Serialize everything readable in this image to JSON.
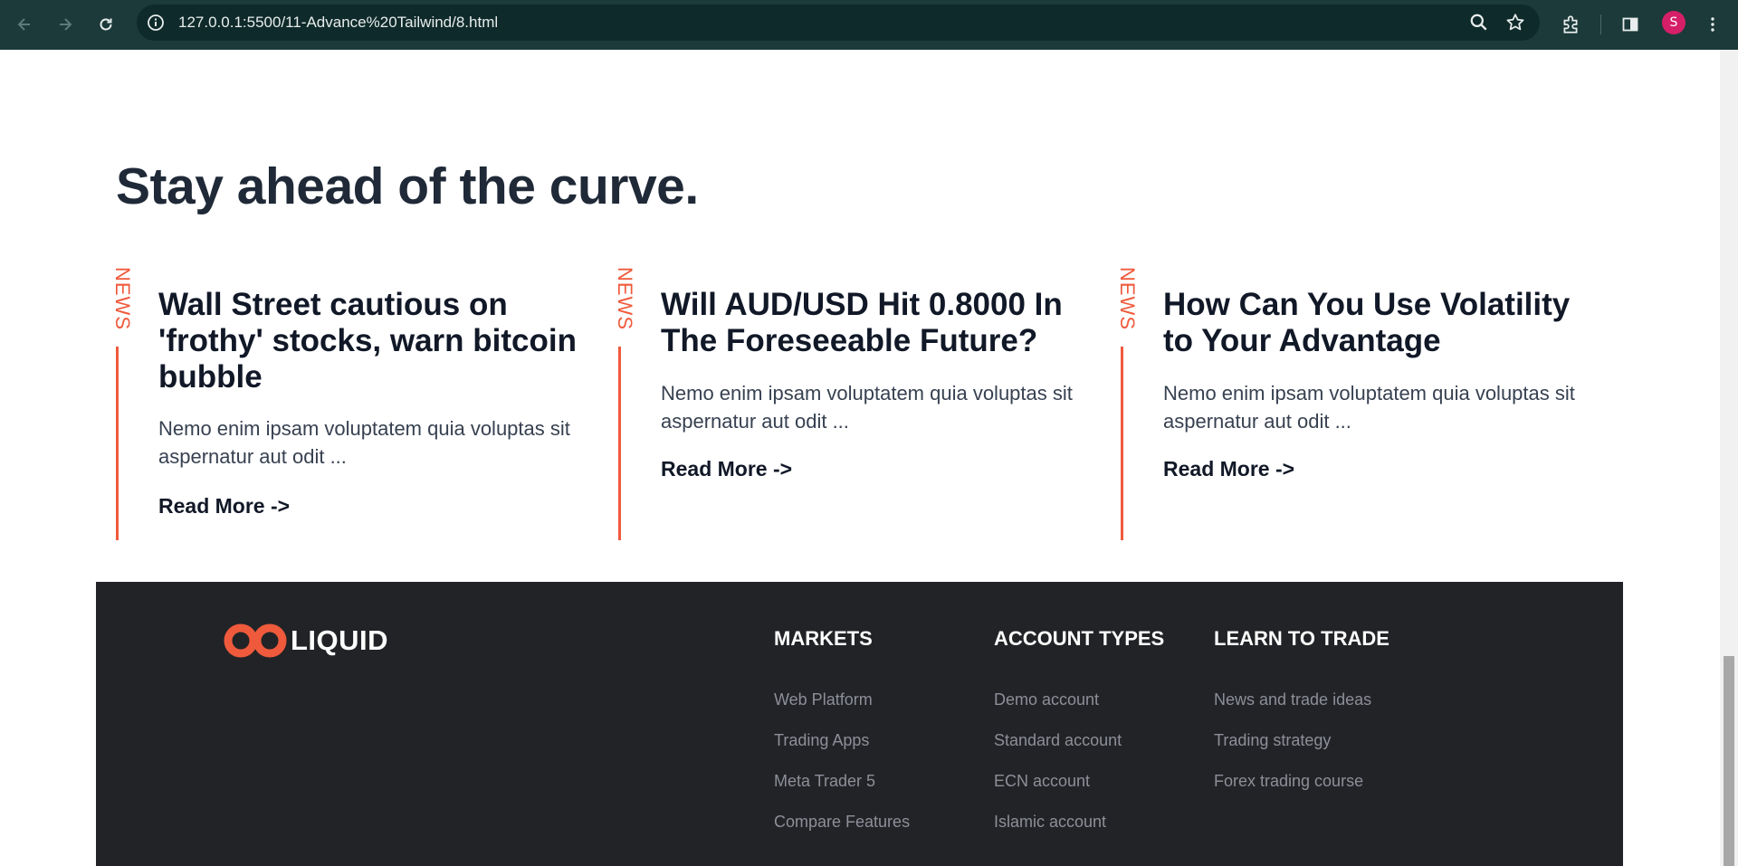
{
  "browser": {
    "url": "127.0.0.1:5500/11-Advance%20Tailwind/8.html",
    "profile_initial": "S",
    "icons": [
      "back-icon",
      "forward-icon",
      "reload-icon",
      "info-icon",
      "zoom-icon",
      "star-icon",
      "extensions-icon",
      "side-panel-icon",
      "menu-icon"
    ]
  },
  "main": {
    "heading": "Stay ahead of the curve.",
    "news": [
      {
        "tag": "NEWS",
        "title": "Wall Street cautious on 'frothy' stocks, warn bitcoin bubble",
        "description": "Nemo enim ipsam voluptatem quia voluptas sit aspernatur aut odit ...",
        "read_more": "Read More ->"
      },
      {
        "tag": "NEWS",
        "title": "Will AUD/USD Hit 0.8000 In The Foreseeable Future?",
        "description": "Nemo enim ipsam voluptatem quia voluptas sit aspernatur aut odit ...",
        "read_more": "Read More ->"
      },
      {
        "tag": "NEWS",
        "title": "How Can You Use Volatility to Your Advantage",
        "description": "Nemo enim ipsam voluptatem quia voluptas sit aspernatur aut odit ...",
        "read_more": "Read More ->"
      }
    ]
  },
  "footer": {
    "logo_text": "LIQUID",
    "columns": [
      {
        "title": "MARKETS",
        "links": [
          "Web Platform",
          "Trading Apps",
          "Meta Trader 5",
          "Compare Features"
        ]
      },
      {
        "title": "ACCOUNT TYPES",
        "links": [
          "Demo account",
          "Standard account",
          "ECN account",
          "Islamic account"
        ]
      },
      {
        "title": "LEARN TO TRADE",
        "links": [
          "News and trade ideas",
          "Trading strategy",
          "Forex trading course"
        ]
      }
    ]
  },
  "colors": {
    "accent": "#ef5a3c",
    "footer_bg": "#222326",
    "heading": "#1f2937",
    "footer_link": "#8d8f99",
    "chrome_bg": "#1c3a3a"
  }
}
